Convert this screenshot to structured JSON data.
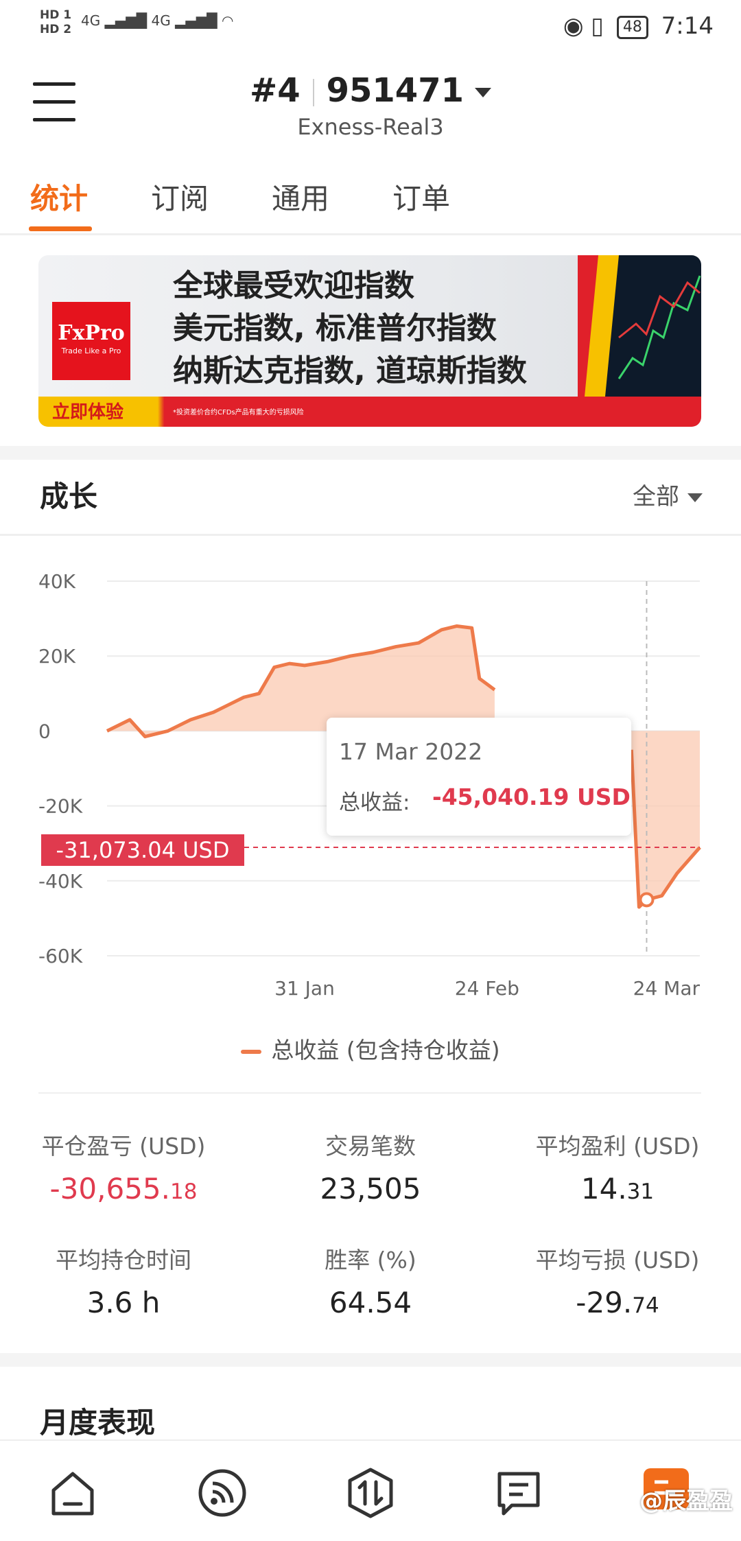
{
  "status_bar": {
    "sim1": "HD 1",
    "sim2": "HD 2",
    "network1": "4G",
    "network2": "4G",
    "battery": "48",
    "time": "7:14"
  },
  "header": {
    "account_prefix": "#4",
    "account_number": "951471",
    "server": "Exness-Real3"
  },
  "tabs": [
    {
      "label": "统计",
      "active": true
    },
    {
      "label": "订阅",
      "active": false
    },
    {
      "label": "通用",
      "active": false
    },
    {
      "label": "订单",
      "active": false
    }
  ],
  "banner": {
    "logo_name": "FxPro",
    "logo_tagline": "Trade Like a Pro",
    "line1": "全球最受欢迎指数",
    "line2": "美元指数, 标准普尔指数",
    "line3": "纳斯达克指数, 道琼斯指数",
    "cta": "立即体验",
    "risk_note": "*投资差价合约CFDs产品有重大的亏损风险"
  },
  "growth": {
    "title": "成长",
    "filter": "全部"
  },
  "chart_data": {
    "type": "area",
    "series": [
      {
        "name": "总收益 (包含持仓收益)",
        "x": [
          "2022-01-05",
          "2022-01-08",
          "2022-01-10",
          "2022-01-13",
          "2022-01-16",
          "2022-01-19",
          "2022-01-21",
          "2022-01-23",
          "2022-01-25",
          "2022-01-27",
          "2022-01-29",
          "2022-01-31",
          "2022-02-03",
          "2022-02-06",
          "2022-02-09",
          "2022-02-12",
          "2022-02-15",
          "2022-02-18",
          "2022-02-20",
          "2022-02-22",
          "2022-02-23",
          "2022-02-24",
          "2022-02-25",
          "2022-03-15",
          "2022-03-16",
          "2022-03-17",
          "2022-03-19",
          "2022-03-21",
          "2022-03-24"
        ],
        "values": [
          0,
          3000,
          -1500,
          0,
          3000,
          5000,
          7000,
          9000,
          10000,
          17000,
          18000,
          17500,
          18500,
          20000,
          21000,
          22500,
          23500,
          27000,
          28000,
          27500,
          14000,
          12500,
          11000,
          -5000,
          -47000,
          -45040.19,
          -44000,
          -38000,
          -31073.04
        ]
      }
    ],
    "xlabel": "",
    "ylabel": "",
    "ylim": [
      -60000,
      40000
    ],
    "yticks": [
      "40K",
      "20K",
      "0",
      "-20K",
      "-40K",
      "-60K"
    ],
    "xticks": [
      "31 Jan",
      "24 Feb",
      "24 Mar"
    ],
    "legend": [
      "总收益 (包含持仓收益)"
    ],
    "legend_position": "bottom",
    "grid": true,
    "current_value_label": "-31,073.04 USD",
    "current_value": -31073.04,
    "tooltip": {
      "date": "17 Mar 2022",
      "label": "总收益:",
      "value": "-45,040.19 USD"
    },
    "line_color": "#ee7a4a",
    "fill_color": "#fbc9b2",
    "negative_color": "#e03a4e"
  },
  "stats": {
    "closed_pnl": {
      "label": "平仓盈亏 (USD)",
      "int": "-30,655.",
      "dec": "18"
    },
    "trades": {
      "label": "交易笔数",
      "value": "23,505"
    },
    "avg_profit": {
      "label": "平均盈利 (USD)",
      "int": "14.",
      "dec": "31"
    },
    "avg_hold": {
      "label": "平均持仓时间",
      "value": "3.6 h"
    },
    "win_rate": {
      "label": "胜率 (%)",
      "value": "64.54"
    },
    "avg_loss": {
      "label": "平均亏损 (USD)",
      "int": "-29.",
      "dec": "74"
    }
  },
  "monthly": {
    "title": "月度表现"
  },
  "bottom_nav": [
    {
      "icon": "home-icon"
    },
    {
      "icon": "signal-icon"
    },
    {
      "icon": "trade-icon"
    },
    {
      "icon": "news-icon"
    },
    {
      "icon": "profile-icon"
    }
  ],
  "watermark": "@辰盈盈"
}
